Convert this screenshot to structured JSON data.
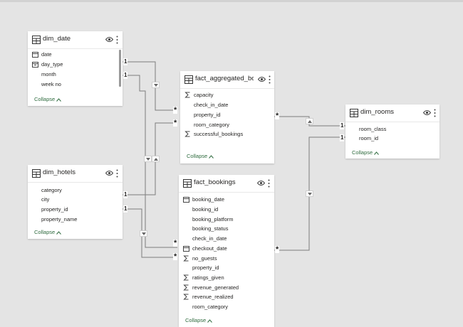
{
  "tables": {
    "dim_date": {
      "title": "dim_date",
      "fields": [
        "date",
        "day_type",
        "month",
        "week no"
      ],
      "collapse": "Collapse"
    },
    "fact_agg": {
      "title": "fact_aggregated_boo...",
      "fields": [
        "capacity",
        "check_in_date",
        "property_id",
        "room_category",
        "successful_bookings"
      ],
      "collapse": "Collapse"
    },
    "dim_rooms": {
      "title": "dim_rooms",
      "fields": [
        "room_class",
        "room_id"
      ],
      "collapse": "Collapse"
    },
    "dim_hotels": {
      "title": "dim_hotels",
      "fields": [
        "category",
        "city",
        "property_id",
        "property_name"
      ],
      "collapse": "Collapse"
    },
    "fact_bookings": {
      "title": "fact_bookings",
      "fields": [
        "booking_date",
        "booking_id",
        "booking_platform",
        "booking_status",
        "check_in_date",
        "checkout_date",
        "no_guests",
        "property_id",
        "ratings_given",
        "revenue_generated",
        "revenue_realized",
        "room_category"
      ],
      "collapse": "Collapse"
    }
  },
  "cardinality": {
    "one": "1",
    "many": "*"
  },
  "icons": {
    "table": "table-icon",
    "eye": "eye-icon",
    "more": "more-options-icon",
    "sigma": "sigma-icon",
    "calendar": "calendar-icon",
    "hierarchy": "date-hierarchy-icon",
    "filter_arrow": "filter-direction-arrow-icon",
    "chevron_up": "chevron-up-icon"
  },
  "colors": {
    "canvas": "#e4e4e4",
    "card": "#ffffff",
    "line": "#7a7a7a",
    "collapse_text": "#2e6b3e"
  }
}
